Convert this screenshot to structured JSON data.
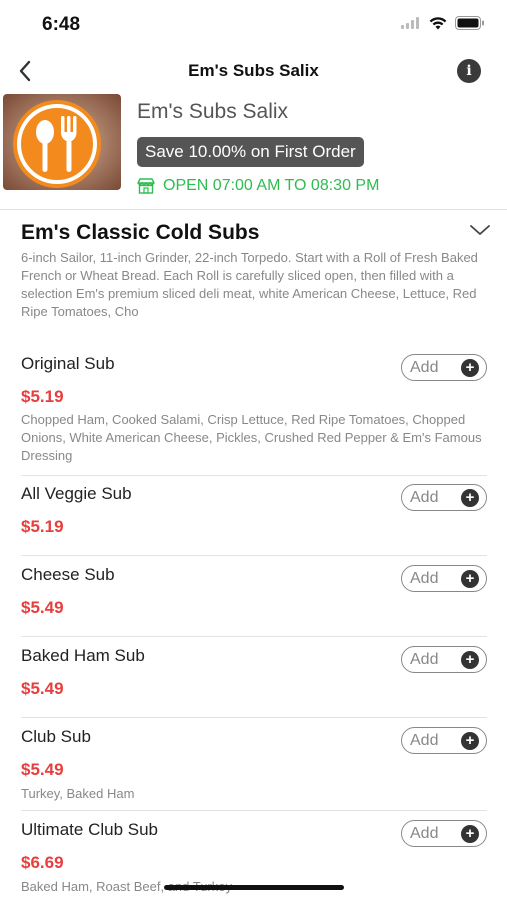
{
  "status": {
    "time": "6:48"
  },
  "nav": {
    "title": "Em's Subs Salix"
  },
  "store": {
    "name": "Em's Subs Salix",
    "promo": "Save 10.00% on First Order",
    "hours": "OPEN 07:00 AM TO 08:30 PM"
  },
  "category": {
    "title": "Em's Classic Cold Subs",
    "description": "6-inch Sailor, 11-inch Grinder, 22-inch Torpedo. Start with a Roll of Fresh Baked French or Wheat Bread. Each Roll is carefully sliced open, then filled with a selection Em's premium sliced deli meat, white American Cheese, Lettuce, Red Ripe Tomatoes, Cho"
  },
  "add_label": "Add",
  "items": [
    {
      "name": "Original Sub",
      "price": "$5.19",
      "desc": "Chopped Ham, Cooked Salami, Crisp Lettuce, Red Ripe Tomatoes, Chopped Onions, White American Cheese, Pickles, Crushed Red Pepper & Em's Famous Dressing"
    },
    {
      "name": "All Veggie Sub",
      "price": "$5.19",
      "desc": ""
    },
    {
      "name": "Cheese Sub",
      "price": "$5.49",
      "desc": ""
    },
    {
      "name": "Baked Ham Sub",
      "price": "$5.49",
      "desc": ""
    },
    {
      "name": "Club Sub",
      "price": "$5.49",
      "desc": "Turkey, Baked Ham"
    },
    {
      "name": "Ultimate Club Sub",
      "price": "$6.69",
      "desc": "Baked Ham, Roast Beef, and Turkey"
    }
  ],
  "colors": {
    "price": "#e83e3e",
    "open": "#2ebd4e",
    "promo_bg": "#555555",
    "logo_orange": "#f28a1e"
  }
}
